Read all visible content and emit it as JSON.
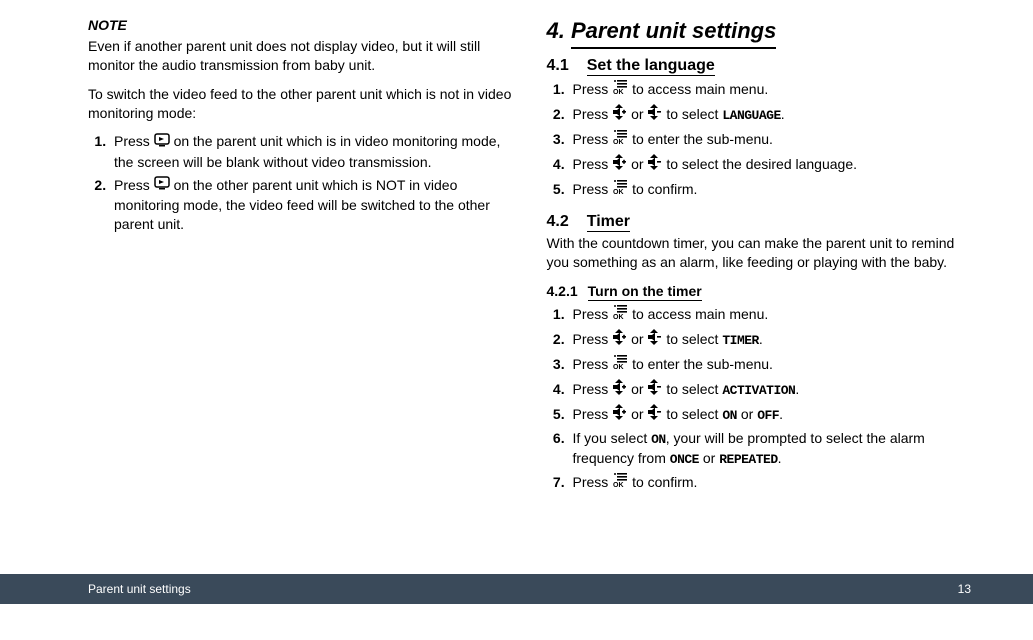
{
  "left": {
    "note_heading": "NOTE",
    "note_body": "Even if another parent unit does not display video, but it will still monitor the audio transmission from baby unit.",
    "switch_intro": "To switch the video feed to the other parent unit which is not in video monitoring mode:",
    "steps": [
      {
        "pre": "Press ",
        "icon": "video",
        "post": " on the parent unit which is in video monitoring mode, the screen will be blank without video transmission."
      },
      {
        "pre": "Press ",
        "icon": "video",
        "post": " on the other parent unit which is NOT in video monitoring mode, the video feed will be switched to the other parent unit."
      }
    ]
  },
  "right": {
    "section_num": "4.",
    "section_title": "Parent unit settings",
    "s41": {
      "num": "4.1",
      "title": "Set the language",
      "steps": [
        {
          "pre": "Press ",
          "icon": "menu-ok",
          "post": " to access main menu."
        },
        {
          "pre": "Press ",
          "icon": "vol-up",
          "mid": " or ",
          "icon2": "vol-down",
          "post": " to select ",
          "mono": "LANGUAGE",
          "tail": "."
        },
        {
          "pre": "Press ",
          "icon": "menu-ok",
          "post": " to enter the sub-menu."
        },
        {
          "pre": "Press ",
          "icon": "vol-up",
          "mid": " or ",
          "icon2": "vol-down",
          "post": " to select the desired language."
        },
        {
          "pre": "Press ",
          "icon": "menu-ok",
          "post": " to confirm."
        }
      ]
    },
    "s42": {
      "num": "4.2",
      "title": "Timer",
      "intro": "With the countdown timer, you can make the parent unit to remind you something as an alarm, like feeding or playing with the baby.",
      "s421": {
        "num": "4.2.1",
        "title": "Turn on the timer",
        "steps": [
          {
            "pre": "Press ",
            "icon": "menu-ok",
            "post": " to access main menu."
          },
          {
            "pre": "Press ",
            "icon": "vol-up",
            "mid": " or ",
            "icon2": "vol-down",
            "post": " to select ",
            "mono": "TIMER",
            "tail": "."
          },
          {
            "pre": "Press ",
            "icon": "menu-ok",
            "post": " to enter the sub-menu."
          },
          {
            "pre": "Press ",
            "icon": "vol-up",
            "mid": " or ",
            "icon2": "vol-down",
            "post": " to select ",
            "mono": "ACTIVATION",
            "tail": "."
          },
          {
            "pre": "Press ",
            "icon": "vol-up",
            "mid": " or ",
            "icon2": "vol-down",
            "post": " to select ",
            "mono": "ON",
            "tail2": " or ",
            "mono2": "OFF",
            "tail3": "."
          },
          {
            "plain_pre": "If you select ",
            "mono": "ON",
            "plain_mid": ", your will be prompted to select the alarm frequency from ",
            "mono2": "ONCE",
            "plain_mid2": " or ",
            "mono3": "REPEATED",
            "plain_tail": "."
          },
          {
            "pre": "Press ",
            "icon": "menu-ok",
            "post": " to confirm."
          }
        ]
      }
    }
  },
  "footer": {
    "title": "Parent unit settings",
    "page": "13"
  }
}
